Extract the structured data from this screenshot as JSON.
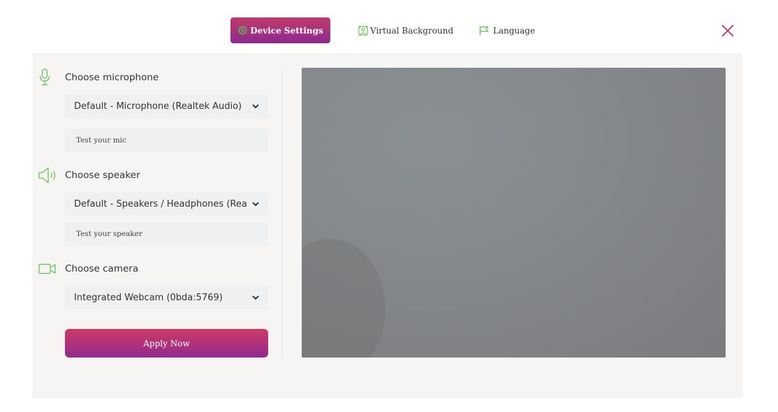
{
  "tabs": [
    {
      "label": "Device Settings",
      "icon": "gear-icon",
      "active": true
    },
    {
      "label": "Virtual Background",
      "icon": "background-icon",
      "active": false
    },
    {
      "label": "Language",
      "icon": "flag-icon",
      "active": false
    }
  ],
  "microphone": {
    "label": "Choose microphone",
    "icon": "microphone-icon",
    "selected": "Default - Microphone (Realtek Audio)",
    "test_label": "Test your mic"
  },
  "speaker": {
    "label": "Choose speaker",
    "icon": "speaker-icon",
    "selected": "Default - Speakers / Headphones (Realtek Audio)",
    "test_label": "Test your speaker"
  },
  "camera": {
    "label": "Choose camera",
    "icon": "camera-icon",
    "selected": "Integrated Webcam (0bda:5769)"
  },
  "apply_label": "Apply Now",
  "colors": {
    "accent_top": "#c23a6a",
    "accent_bottom": "#8c2a8f",
    "icon_green": "#5cc24f",
    "close": "#c0335c",
    "panel_bg": "#f6f5f3",
    "field_bg": "#eef0f1"
  }
}
